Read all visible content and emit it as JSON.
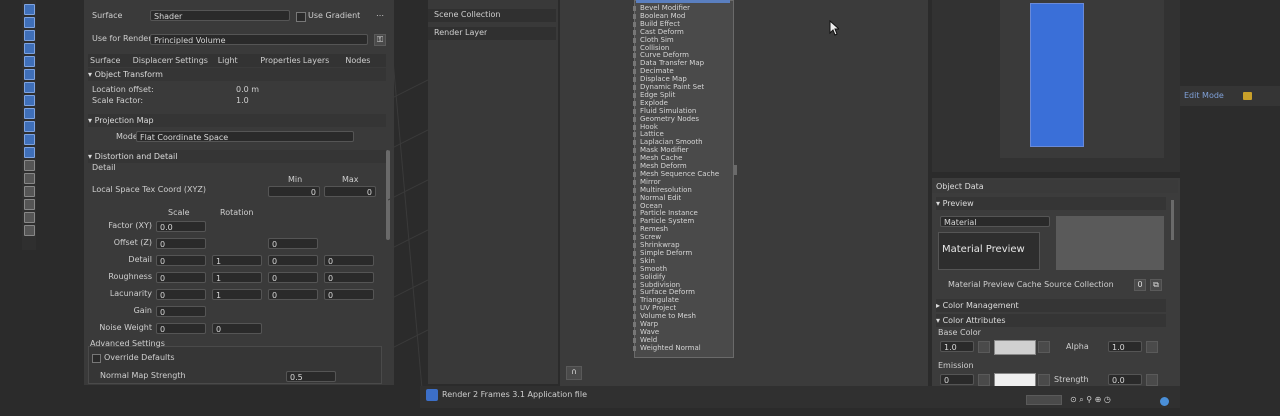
{
  "left_toolbar": {
    "icons": [
      "cursor-icon",
      "move-icon",
      "rotate-icon",
      "scale-icon",
      "transform-icon",
      "annotate-icon",
      "measure-icon",
      "brush-icon",
      "paint-icon",
      "sculpt-icon",
      "node-icon",
      "camera-icon",
      "grid-icon",
      "square-icon",
      "doc-icon",
      "filter-icon",
      "funnel-icon",
      "circle-icon"
    ]
  },
  "material_panel": {
    "top_label": "Surface",
    "top_value": "Shader",
    "checkbox_label": "Use Gradient",
    "use_for_label": "Use for Render",
    "use_for_value": "Principled Volume",
    "tabs": [
      "Surface",
      "Displacement",
      "Settings",
      "Light",
      "Properties",
      "Layers",
      "Nodes"
    ],
    "section_header_1": "Object Transform",
    "transform_rows": [
      {
        "label": "Location offset:",
        "value": "0.0 m"
      },
      {
        "label": "Scale Factor:",
        "value": "1.0"
      }
    ],
    "section_header_2": "Projection Map",
    "projection_label": "Mode",
    "projection_value": "Flat Coordinate Space",
    "section_header_3": "Distortion and Detail",
    "sub_label": "Detail",
    "grid_title": "Local Space Tex Coord (XYZ)",
    "grid_col_headers": [
      "Min",
      "Max"
    ],
    "grid_min_value": "0",
    "grid_max_value": "0",
    "grid_cols": [
      "Scale",
      "Rotation"
    ],
    "grid_rows": [
      {
        "label": "Factor (XY)",
        "v1": "0.0",
        "v2": "",
        "v3": "",
        "v4": ""
      },
      {
        "label": "Offset (Z)",
        "v1": "0",
        "v2": "",
        "v3": "0",
        "v4": ""
      },
      {
        "label": "Detail",
        "v1": "0",
        "v2": "1",
        "v3": "0",
        "v4": "0"
      },
      {
        "label": "Roughness",
        "v1": "0",
        "v2": "1",
        "v3": "0",
        "v4": "0"
      },
      {
        "label": "Lacunarity",
        "v1": "0",
        "v2": "1",
        "v3": "0",
        "v4": "0"
      },
      {
        "label": "Gain",
        "v1": "0",
        "v2": "",
        "v3": "",
        "v4": ""
      },
      {
        "label": "Noise Weight",
        "v1": "0",
        "v2": "0",
        "v3": "",
        "v4": ""
      }
    ],
    "bottom_section": "Advanced Settings",
    "bottom_items": [
      {
        "label": "Override Defaults"
      },
      {
        "label": "Normal Map Strength",
        "value": "0.5"
      }
    ]
  },
  "outliner": {
    "items": [
      "Scene Collection",
      "Render Layer"
    ]
  },
  "center_list": {
    "items": [
      "Bevel Modifier",
      "Boolean Mod",
      "Build Effect",
      "Cast Deform",
      "Cloth Sim",
      "Collision",
      "Curve Deform",
      "Data Transfer Map",
      "Decimate",
      "Displace Map",
      "Dynamic Paint Set",
      "Edge Split",
      "Explode",
      "Fluid Simulation",
      "Geometry Nodes",
      "Hook",
      "Lattice",
      "Laplacian Smooth",
      "Mask Modifier",
      "Mesh Cache",
      "Mesh Deform",
      "Mesh Sequence Cache",
      "Mirror",
      "Multiresolution",
      "Normal Edit",
      "Ocean",
      "Particle Instance",
      "Particle System",
      "Remesh",
      "Screw",
      "Shrinkwrap",
      "Simple Deform",
      "Skin",
      "Smooth",
      "Solidify",
      "Subdivision",
      "Surface Deform",
      "Triangulate",
      "UV Project",
      "Volume to Mesh",
      "Warp",
      "Wave",
      "Weld",
      "Weighted Normal"
    ]
  },
  "viewport_preview": {
    "bar_color": "#3a6fd8"
  },
  "right_panel": {
    "header": "Object Data",
    "section_1": "Preview",
    "dropdown_value": "Material",
    "preview_text": "Material Preview",
    "caption": "Material Preview Cache Source Collection",
    "caption_value": "0",
    "section_2": "Color Management",
    "section_3": "Color Attributes",
    "sub_1": "Base Color",
    "sub_1_value": "1.0",
    "sub_1_label": "Alpha",
    "sub_1_field": "1.0",
    "sub_2": "Emission",
    "sub_2_value": "0",
    "sub_2_label": "Strength",
    "sub_2_field": "0.0"
  },
  "far_right": {
    "text": "Edit Mode"
  },
  "statusbar": {
    "text": "Render 2 Frames 3.1 Application file"
  }
}
